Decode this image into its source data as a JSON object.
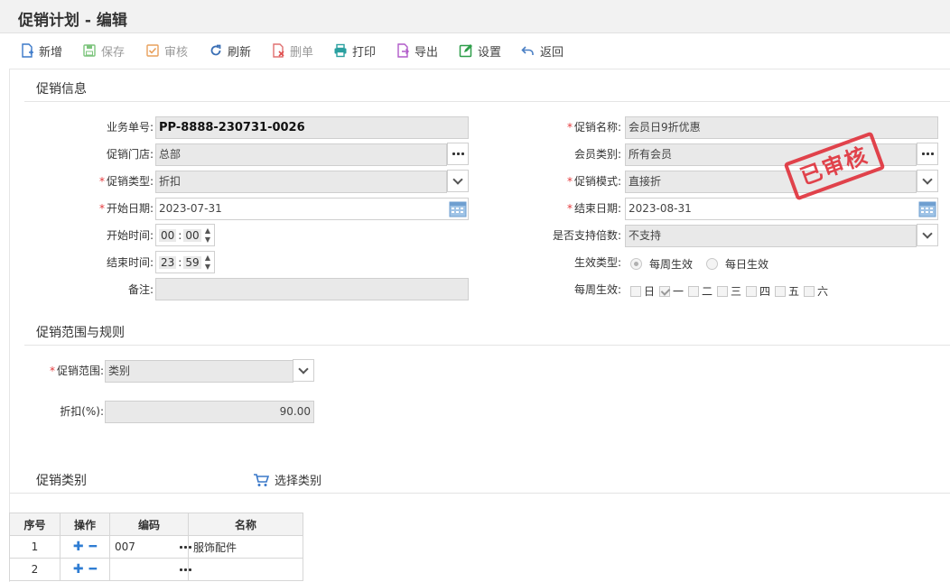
{
  "header": {
    "title": "促销计划 - 编辑"
  },
  "toolbar": {
    "new": "新增",
    "save": "保存",
    "audit": "审核",
    "refresh": "刷新",
    "delete": "删单",
    "print": "打印",
    "export": "导出",
    "settings": "设置",
    "back": "返回"
  },
  "info": {
    "section_title": "促销信息",
    "order_no_label": "业务单号:",
    "order_no": "PP-8888-230731-0026",
    "store_label": "促销门店:",
    "store": "总部",
    "type_label": "促销类型:",
    "type": "折扣",
    "start_date_label": "开始日期:",
    "start_date": "2023-07-31",
    "start_time_label": "开始时间:",
    "start_hour": "00",
    "start_min": "00",
    "end_time_label": "结束时间:",
    "end_hour": "23",
    "end_min": "59",
    "remark_label": "备注:",
    "remark": "",
    "name_label": "促销名称:",
    "name": "会员日9折优惠",
    "member_label": "会员类别:",
    "member": "所有会员",
    "mode_label": "促销模式:",
    "mode": "直接折",
    "end_date_label": "结束日期:",
    "end_date": "2023-08-31",
    "multi_label": "是否支持倍数:",
    "multi": "不支持",
    "effect_type_label": "生效类型:",
    "effect_weekly": "每周生效",
    "effect_daily": "每日生效",
    "weekly_label": "每周生效:",
    "weekdays": [
      "日",
      "一",
      "二",
      "三",
      "四",
      "五",
      "六"
    ],
    "stamp": "已审核"
  },
  "scope": {
    "section_title": "促销范围与规则",
    "range_label": "促销范围:",
    "range": "类别",
    "discount_label": "折扣(%):",
    "discount": "90.00"
  },
  "category": {
    "section_title": "促销类别",
    "select_label": "选择类别",
    "columns": [
      "序号",
      "操作",
      "编码",
      "名称"
    ],
    "rows": [
      {
        "no": "1",
        "code": "007",
        "name": "服饰配件"
      },
      {
        "no": "2",
        "code": "",
        "name": ""
      }
    ]
  }
}
